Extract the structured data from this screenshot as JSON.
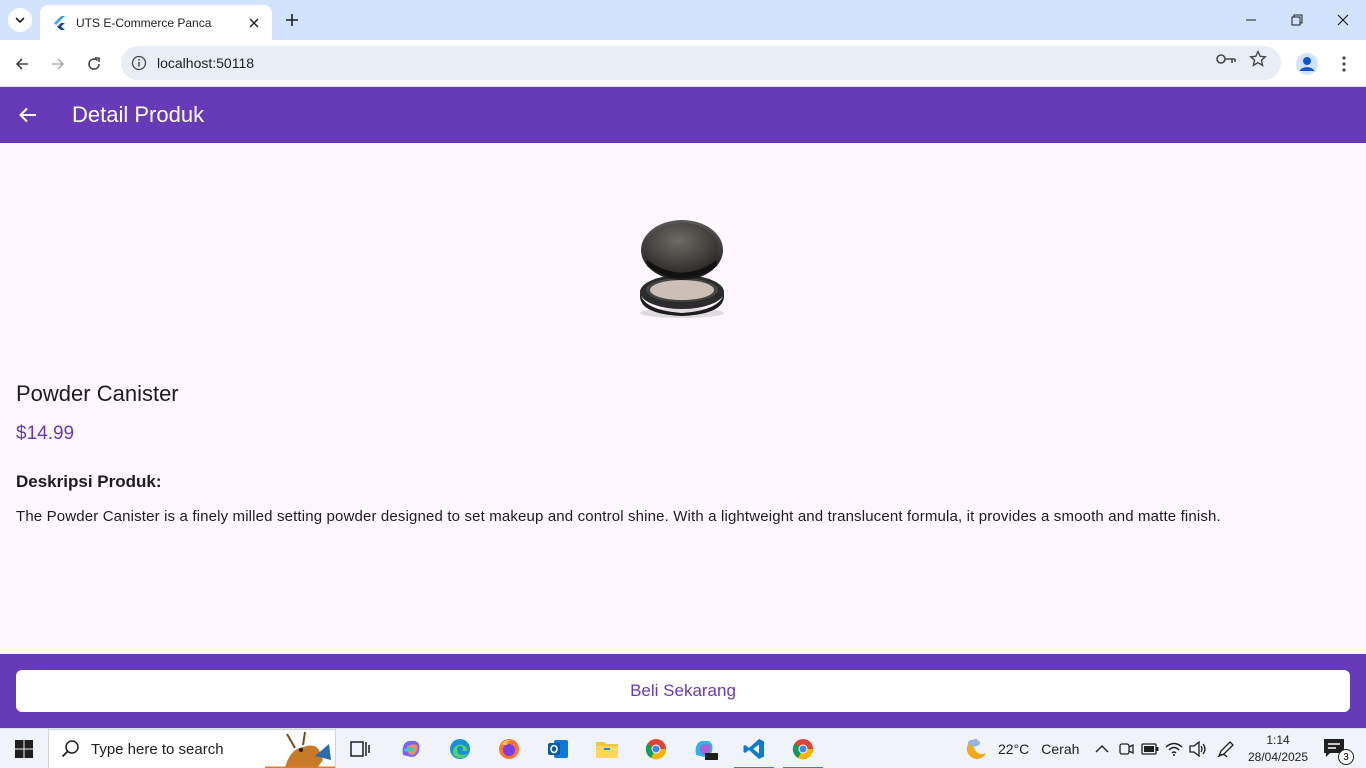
{
  "browser": {
    "tab_title": "UTS E-Commerce Panca",
    "url": "localhost:50118"
  },
  "app": {
    "appbar_title": "Detail Produk",
    "product": {
      "name": "Powder Canister",
      "price": "$14.99",
      "description_heading": "Deskripsi Produk:",
      "description": "The Powder Canister is a finely milled setting powder designed to set makeup and control shine. With a lightweight and translucent formula, it provides a smooth and matte finish."
    },
    "buy_button": "Beli Sekarang",
    "colors": {
      "primary": "#673ab7",
      "background": "#fef7ff"
    }
  },
  "taskbar": {
    "search_placeholder": "Type here to search",
    "weather_temp": "22°C",
    "weather_condition": "Cerah",
    "time": "1:14",
    "date": "28/04/2025",
    "notification_count": "3"
  }
}
